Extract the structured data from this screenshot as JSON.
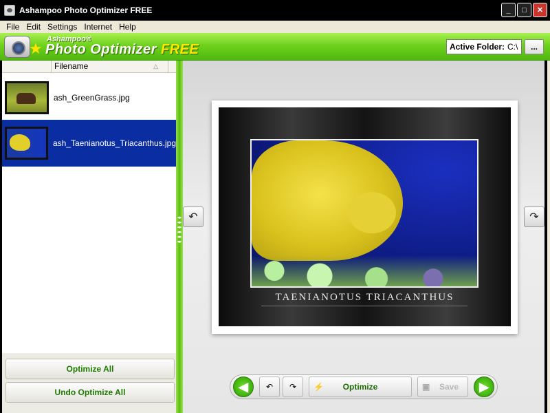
{
  "window": {
    "title": "Ashampoo Photo Optimizer FREE",
    "minimize_glyph": "_",
    "maximize_glyph": "□",
    "close_glyph": "✕"
  },
  "menu": {
    "items": [
      "File",
      "Edit",
      "Settings",
      "Internet",
      "Help"
    ]
  },
  "banner": {
    "logo_sub": "Ashampoo®",
    "logo_main": "Photo Optimizer",
    "logo_free": "FREE",
    "active_folder_label": "Active Folder:",
    "active_folder_value": "C:\\",
    "browse_label": "..."
  },
  "file_list": {
    "column_header": "Filename",
    "sort_glyph": "△",
    "items": [
      {
        "name": "ash_GreenGrass.jpg",
        "selected": false
      },
      {
        "name": "ash_Taenianotus_Triacanthus.jpg",
        "selected": true
      }
    ]
  },
  "actions": {
    "optimize_all": "Optimize All",
    "undo_optimize_all": "Undo Optimize All"
  },
  "preview": {
    "caption": "TAENIANOTUS TRIACANTHUS",
    "rotate_left_icon": "↶",
    "rotate_right_icon": "↷"
  },
  "toolbar": {
    "prev_icon": "◀",
    "rotate_left_icon": "↶",
    "rotate_right_icon": "↷",
    "optimize_label": "Optimize",
    "save_label": "Save",
    "next_icon": "▶"
  },
  "colors": {
    "brand_green": "#5cbf14",
    "selection_blue": "#0a2da2",
    "free_yellow": "#ffe600"
  }
}
